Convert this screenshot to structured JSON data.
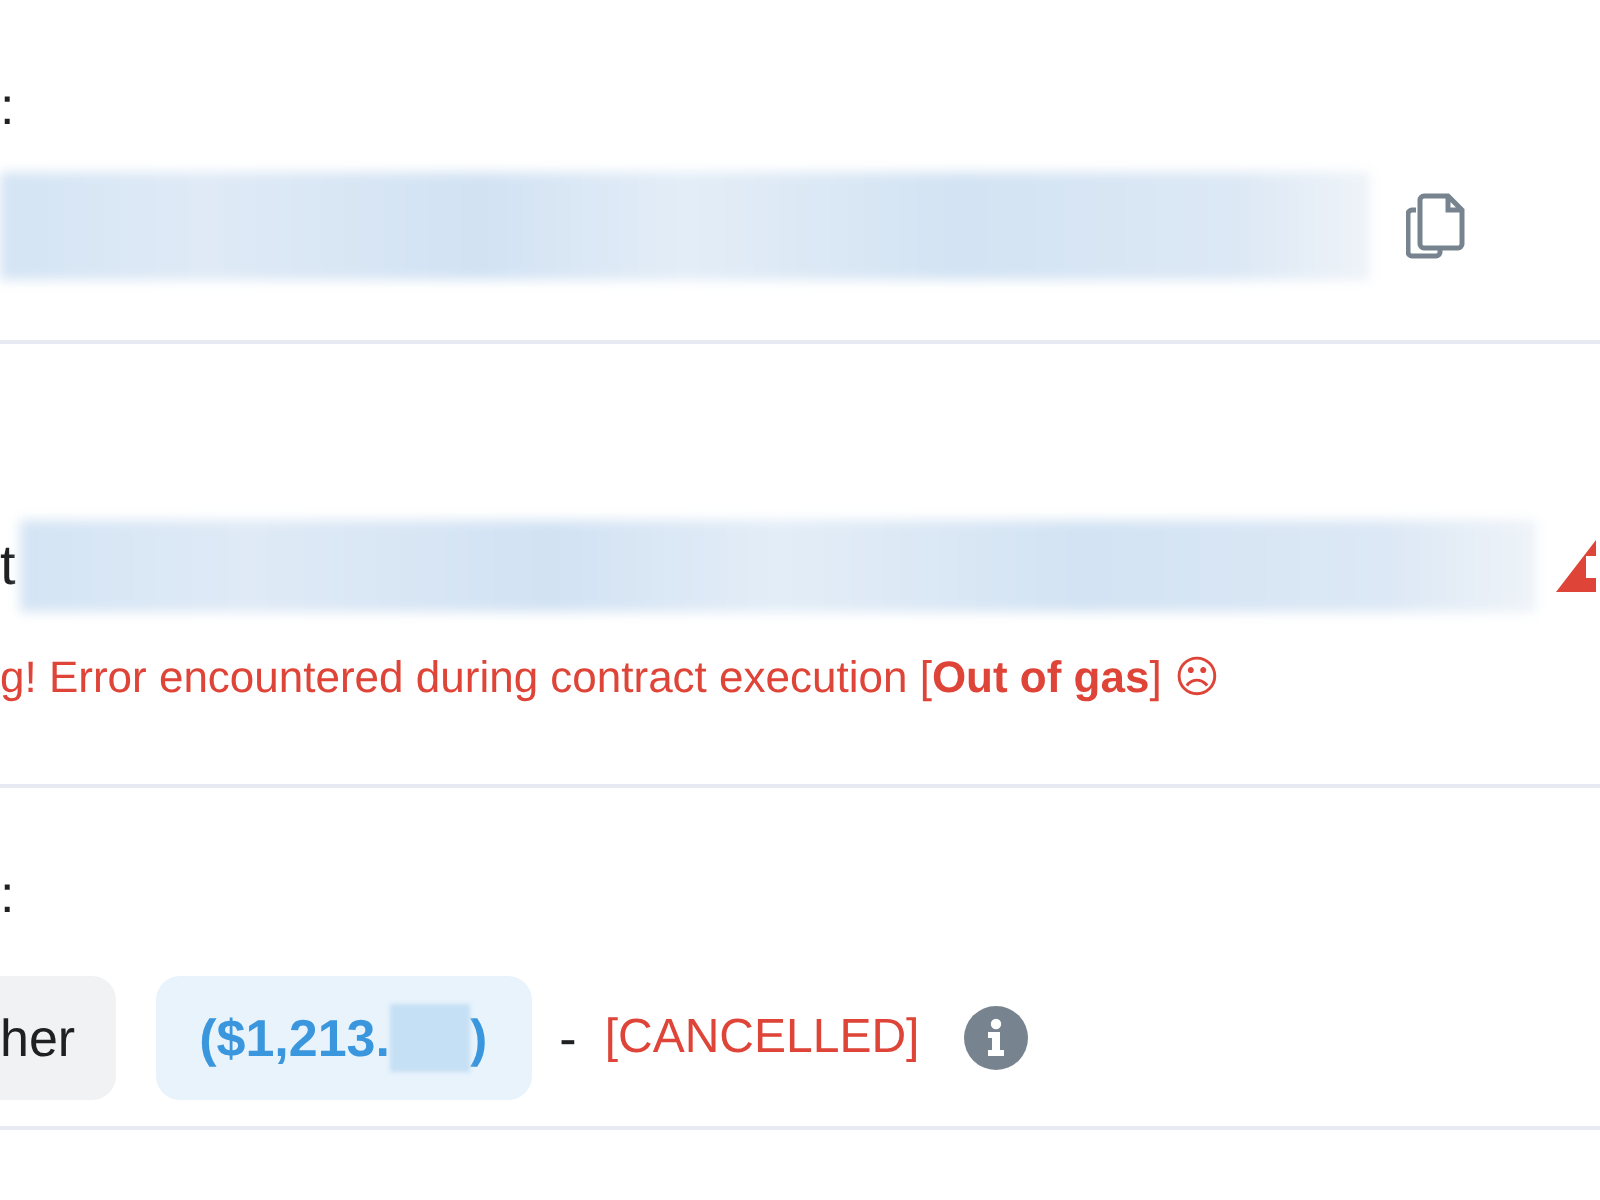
{
  "address_row": {
    "label": ":"
  },
  "contract_row": {
    "label": "t",
    "error": "g! Error encountered during contract execution [**Out of gas**] ☹"
  },
  "value_row": {
    "label": ":",
    "amount": "her",
    "usd": "($1,213.",
    "usd_end": ")",
    "separator": "-",
    "status": "[CANCELLED]"
  }
}
